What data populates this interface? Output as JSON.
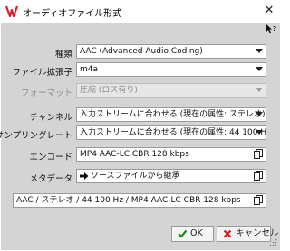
{
  "window": {
    "title": "オーディオファイル形式",
    "close_glyph": "✕"
  },
  "form": {
    "type": {
      "label": "種類",
      "value": "AAC (Advanced Audio Coding)"
    },
    "extension": {
      "label": "ファイル拡張子",
      "value": "m4a"
    },
    "format": {
      "label": "フォーマット",
      "value": "圧縮 (ロス有り)"
    },
    "channel": {
      "label": "チャンネル",
      "value": "入力ストリームに合わせる (現在の属性: ステレオ)"
    },
    "samplerate": {
      "label": "サンプリングレート",
      "value": "入力ストリームに合わせる (現在の属性: 44 100 Hz)"
    },
    "encode": {
      "label": "エンコード",
      "value": "MP4 AAC-LC CBR 128 kbps"
    },
    "metadata": {
      "label": "メタデータ",
      "value": "ソースファイルから継承"
    }
  },
  "summary": {
    "value": "AAC / ステレオ / 44 100 Hz / MP4 AAC-LC CBR 128 kbps"
  },
  "buttons": {
    "ok_label": "OK",
    "cancel_label": "キャンセル"
  },
  "colors": {
    "accent_red": "#d81e2a",
    "ok_green": "#1a8a1a",
    "cancel_red": "#cc2020",
    "panel": "#d4d4d4"
  }
}
